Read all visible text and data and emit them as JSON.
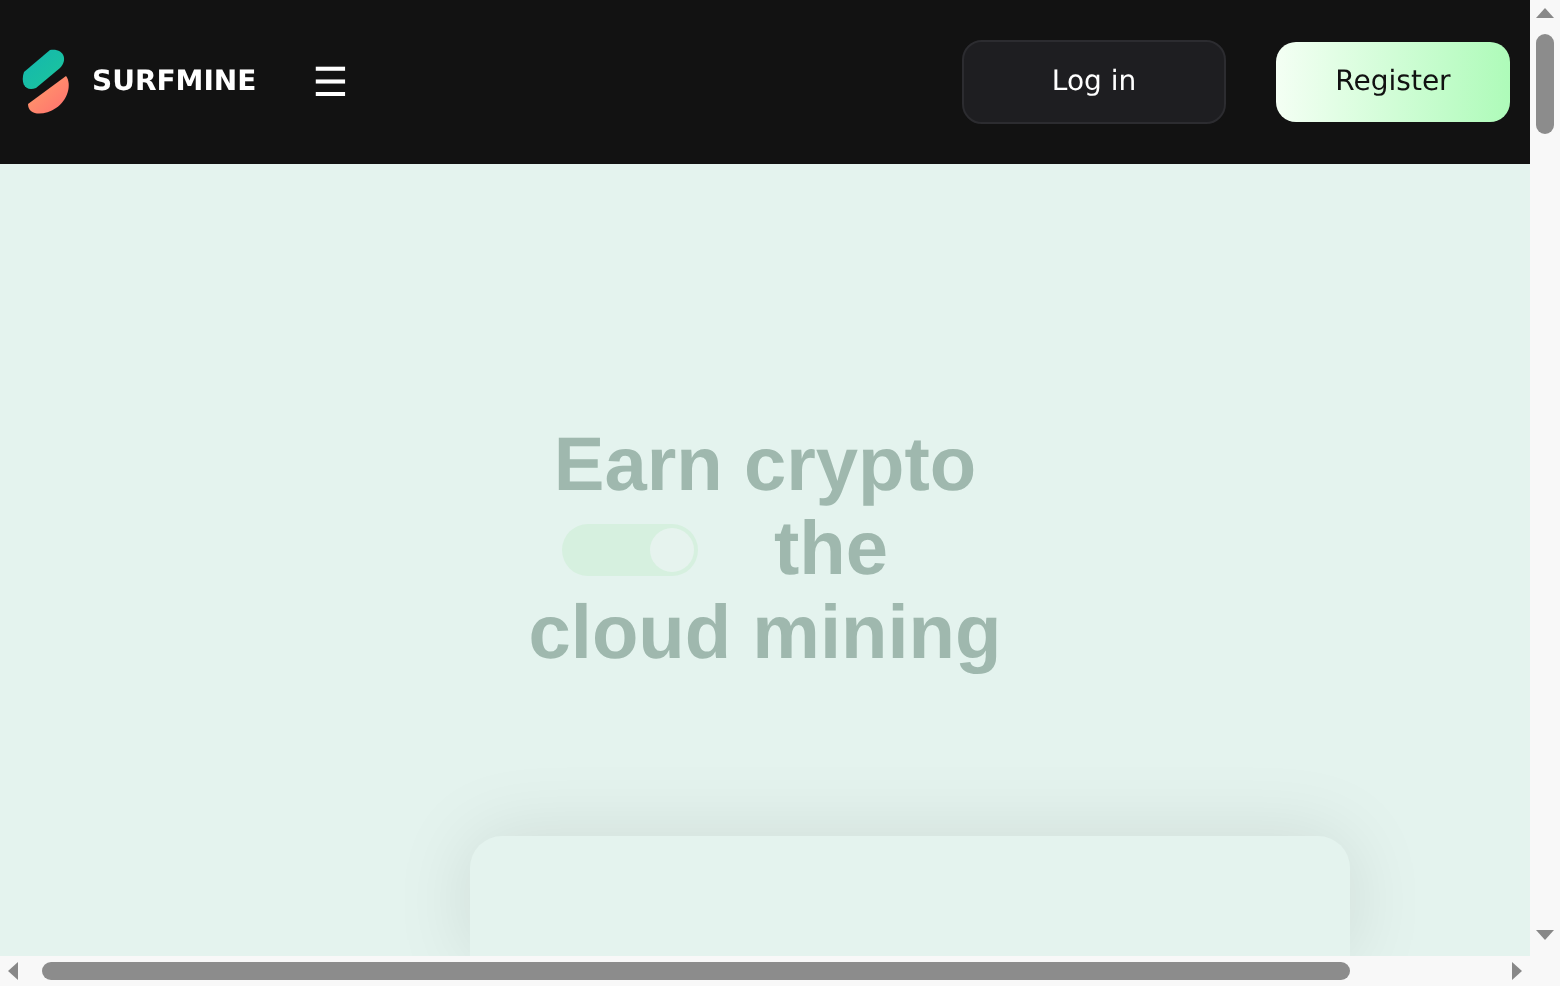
{
  "header": {
    "brand": "SURFMINE",
    "menu_icon": "☰",
    "login": "Log in",
    "register": "Register"
  },
  "hero": {
    "line_1": "Earn crypto",
    "toggle": {
      "on": true
    },
    "line_2": "the",
    "line_3": "cloud mining"
  },
  "card": {
    "kind": "panel"
  }
}
